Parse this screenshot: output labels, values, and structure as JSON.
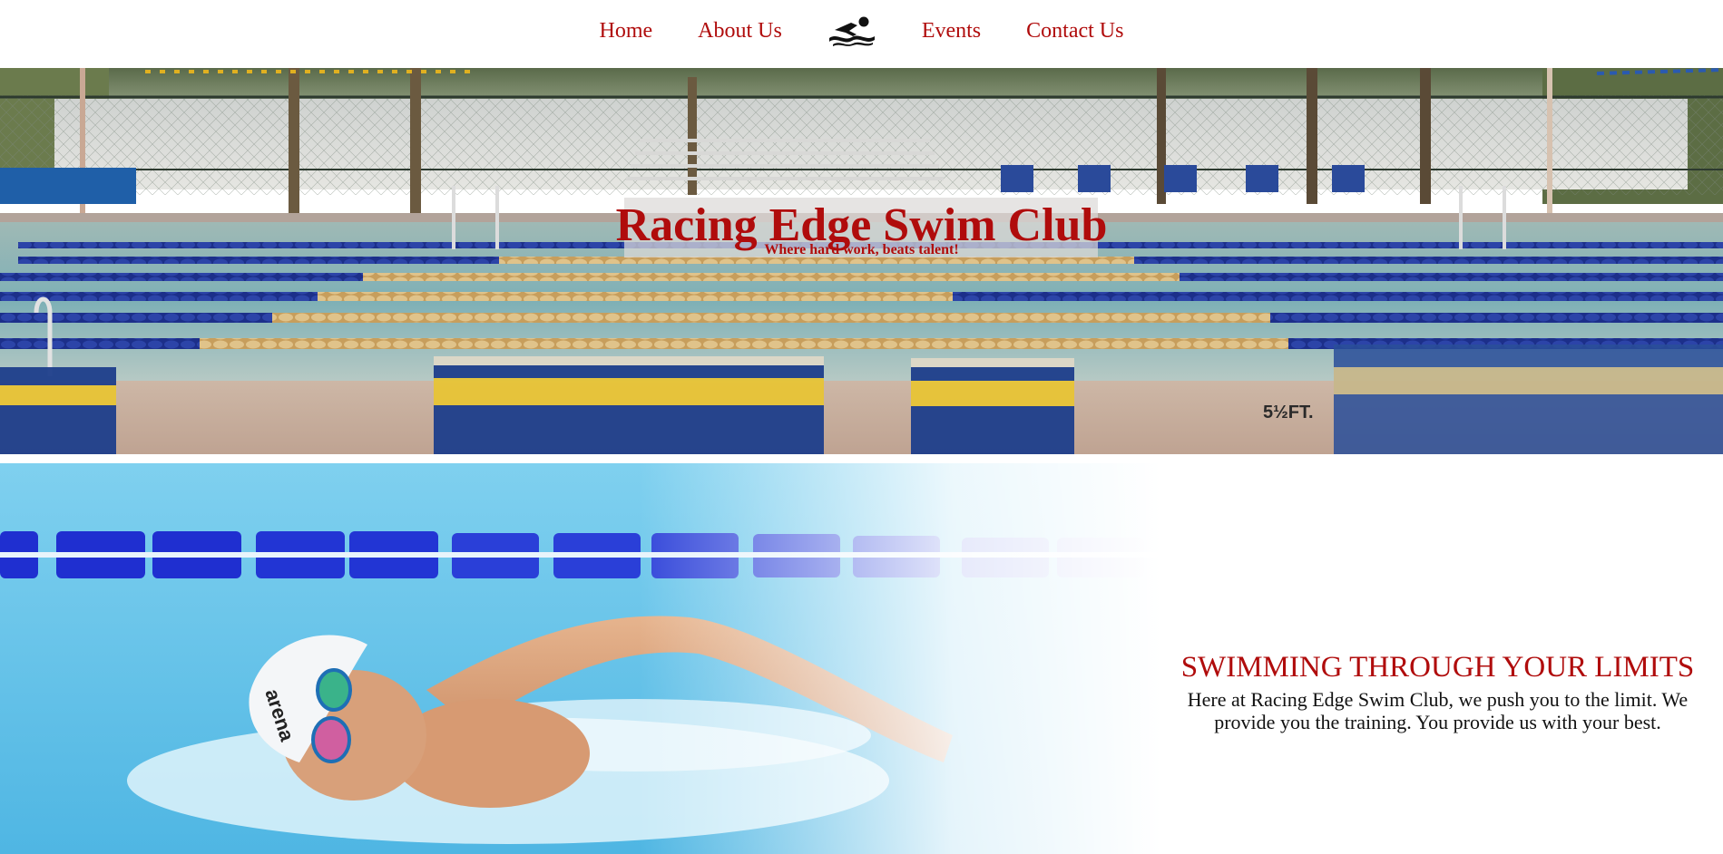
{
  "nav": {
    "links_left": [
      {
        "label": "Home"
      },
      {
        "label": "About Us"
      }
    ],
    "logo_icon": "swimmer-icon",
    "links_right": [
      {
        "label": "Events"
      },
      {
        "label": "Contact Us"
      }
    ]
  },
  "hero": {
    "title": "Racing Edge Swim Club",
    "subtitle": "Where hard work, beats talent!",
    "lane_marker_text": "5½FT."
  },
  "feature": {
    "heading": "SWIMMING THROUGH YOUR LIMITS",
    "body": "Here at Racing Edge Swim Club, we push you to the limit. We provide you the training. You provide us with your best."
  },
  "colors": {
    "accent": "#b00c0c",
    "pool_water": "#6fb3d8",
    "lane_blue": "#1c2f8a",
    "lane_gold": "#d9b46a",
    "chair_yellow": "#e7c436"
  }
}
